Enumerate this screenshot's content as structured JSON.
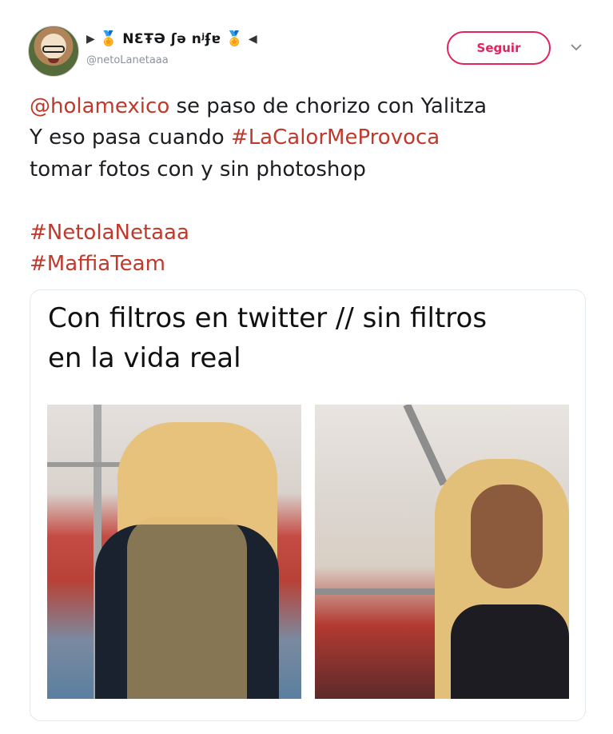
{
  "author": {
    "display_name": "NƐŦƏ ʃə nʲʄɐ",
    "handle": "@netoLanetaaa"
  },
  "follow_label": "Seguir",
  "tweet": {
    "line1_mention": "@holamexico",
    "line1_rest": " se paso de chorizo con Yalitza",
    "line2_start": "Y eso pasa cuando ",
    "line2_tag": "#LaCalorMeProvoca",
    "line3": "tomar fotos con y sin photoshop",
    "tag_1": "#NetolaNetaaa",
    "tag_2": "#MaffiaTeam"
  },
  "card": {
    "caption_line1": "Con filtros en twitter  // sin filtros",
    "caption_line2": "en la vida real"
  },
  "icons": {
    "medal": "medal-icon",
    "chevron": "chevron-down-icon"
  },
  "colors": {
    "accent": "#e0245e",
    "link": "#c0392b"
  }
}
